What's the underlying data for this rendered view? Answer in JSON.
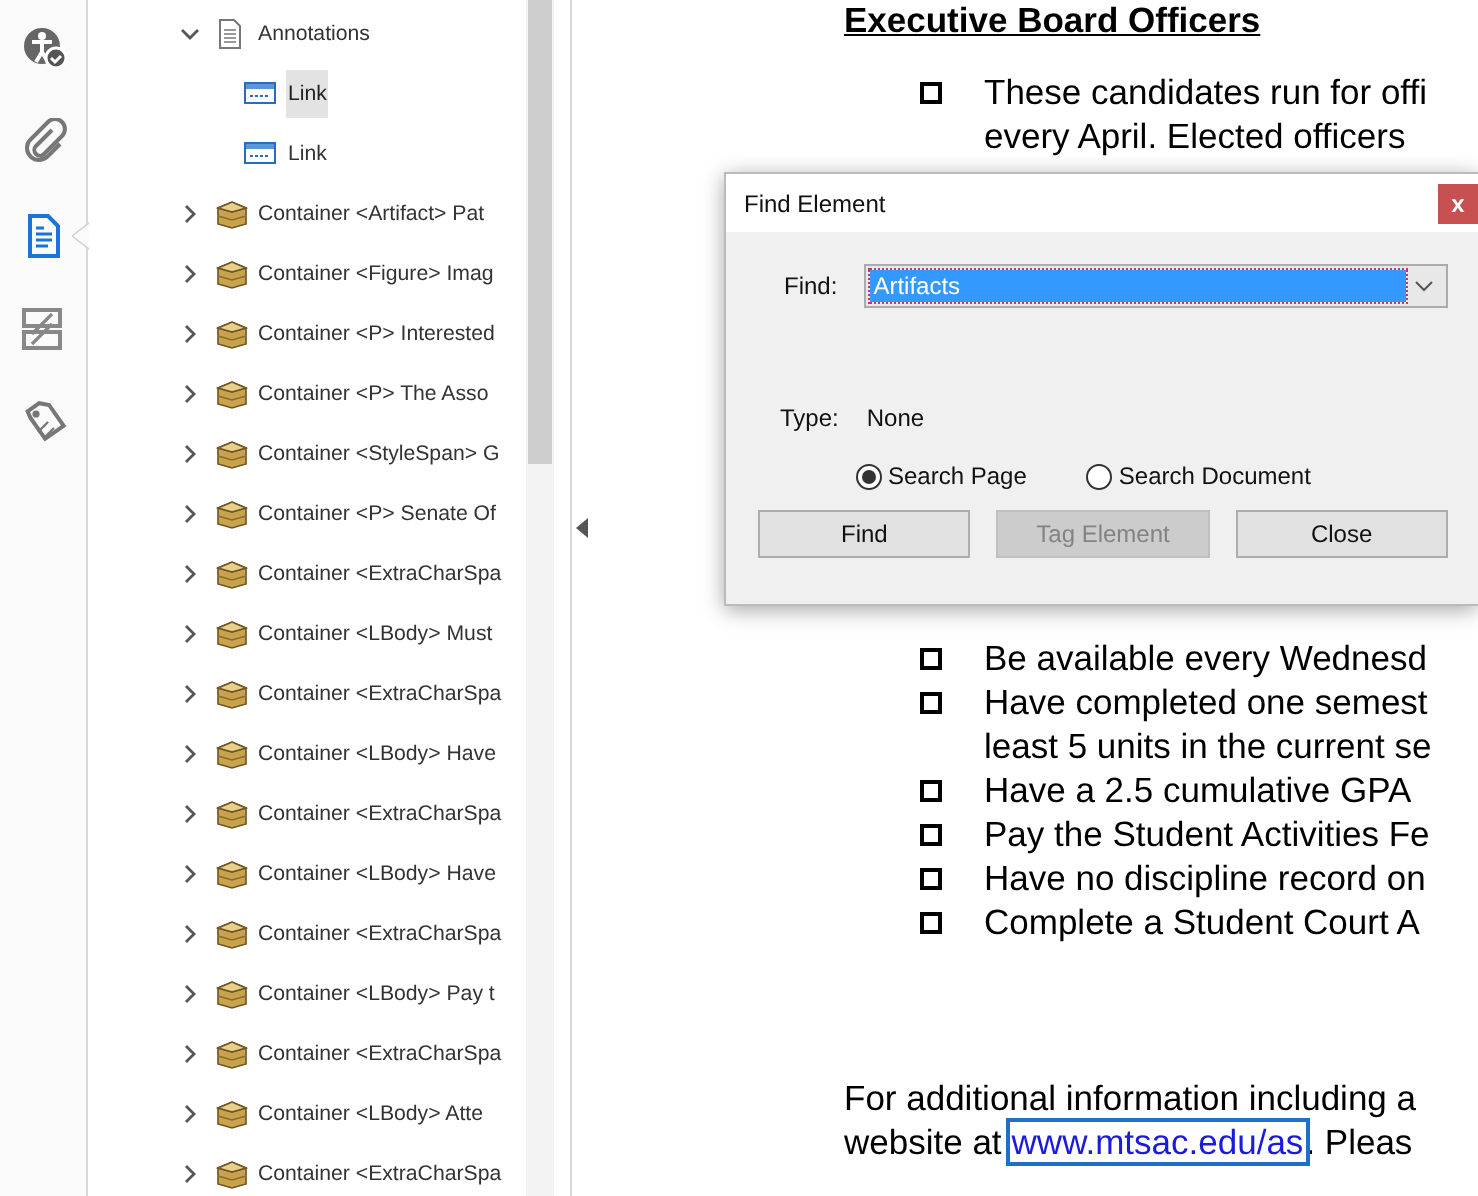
{
  "rail": [
    {
      "selected": false
    },
    {
      "selected": false
    },
    {
      "selected": true
    },
    {
      "selected": false
    },
    {
      "selected": false
    }
  ],
  "tree": {
    "items": [
      {
        "kind": "page",
        "label": "Annotations",
        "expanded": true,
        "children": [
          {
            "kind": "link",
            "label": "Link",
            "selected": true
          },
          {
            "kind": "link",
            "label": "Link",
            "selected": false
          }
        ]
      },
      {
        "kind": "container",
        "label": "Container <Artifact> Pat",
        "expanded": false
      },
      {
        "kind": "container",
        "label": "Container <Figure> Imag",
        "expanded": false
      },
      {
        "kind": "container",
        "label": "Container <P> Interested",
        "expanded": false
      },
      {
        "kind": "container",
        "label": "Container <P> The Asso",
        "expanded": false
      },
      {
        "kind": "container",
        "label": "Container <StyleSpan> G",
        "expanded": false
      },
      {
        "kind": "container",
        "label": "Container <P> Senate Of",
        "expanded": false
      },
      {
        "kind": "container",
        "label": "Container <ExtraCharSpa",
        "expanded": false
      },
      {
        "kind": "container",
        "label": "Container <LBody> Must",
        "expanded": false
      },
      {
        "kind": "container",
        "label": "Container <ExtraCharSpa",
        "expanded": false
      },
      {
        "kind": "container",
        "label": "Container <LBody> Have",
        "expanded": false
      },
      {
        "kind": "container",
        "label": "Container <ExtraCharSpa",
        "expanded": false
      },
      {
        "kind": "container",
        "label": "Container <LBody> Have",
        "expanded": false
      },
      {
        "kind": "container",
        "label": "Container <ExtraCharSpa",
        "expanded": false
      },
      {
        "kind": "container",
        "label": "Container <LBody> Pay t",
        "expanded": false
      },
      {
        "kind": "container",
        "label": "Container <ExtraCharSpa",
        "expanded": false
      },
      {
        "kind": "container",
        "label": "Container <LBody> Atte",
        "expanded": false
      },
      {
        "kind": "container",
        "label": "Container <ExtraCharSpa",
        "expanded": false
      }
    ]
  },
  "document": {
    "heading": "Executive Board Officers",
    "sections": [
      {
        "items": [
          {
            "lines": [
              "These candidates run for offi",
              "every April.  Elected officers"
            ]
          }
        ]
      },
      {
        "items": [
          {
            "lines": [
              "Be available every Wednesd"
            ]
          },
          {
            "lines": [
              "Have completed one semest",
              "least 5 units in the current se"
            ]
          },
          {
            "lines": [
              "Have a 2.5 cumulative GPA"
            ]
          },
          {
            "lines": [
              "Pay the Student Activities Fe"
            ]
          },
          {
            "lines": [
              "Have no discipline record on"
            ]
          },
          {
            "lines": [
              "Complete a Student Court A"
            ]
          }
        ]
      }
    ],
    "paragraph": {
      "line_1": "For additional information including a",
      "line_2_before": "website at",
      "link": "www.mtsac.edu/as",
      "line_2_after": ".  Pleas"
    }
  },
  "dialog": {
    "title": "Find Element",
    "close_label": "x",
    "find_label": "Find:",
    "find_value": "Artifacts",
    "type_label": "Type:",
    "type_value": "None",
    "options": [
      {
        "label": "Search Page",
        "selected": true
      },
      {
        "label": "Search Document",
        "selected": false
      }
    ],
    "buttons": [
      {
        "label": "Find",
        "disabled": false
      },
      {
        "label": "Tag Element",
        "disabled": true
      },
      {
        "label": "Close",
        "disabled": false
      }
    ]
  }
}
